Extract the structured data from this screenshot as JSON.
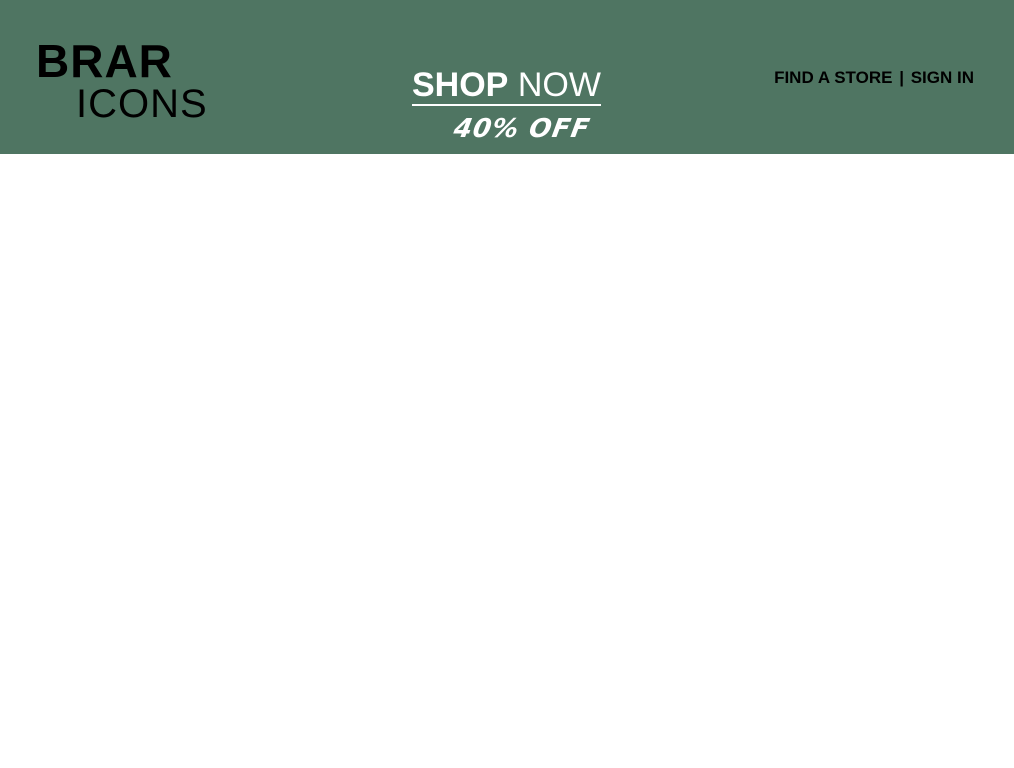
{
  "header": {
    "background_color": "#4f7562",
    "logo": {
      "line1": "BRAR",
      "line2": "ICONS"
    },
    "promo": {
      "shop": "SHOP",
      "now": "NOW",
      "discount": "40% OFF"
    },
    "links": {
      "find_store": "FIND A STORE",
      "separator": "|",
      "sign_in": "SIGN IN"
    }
  }
}
